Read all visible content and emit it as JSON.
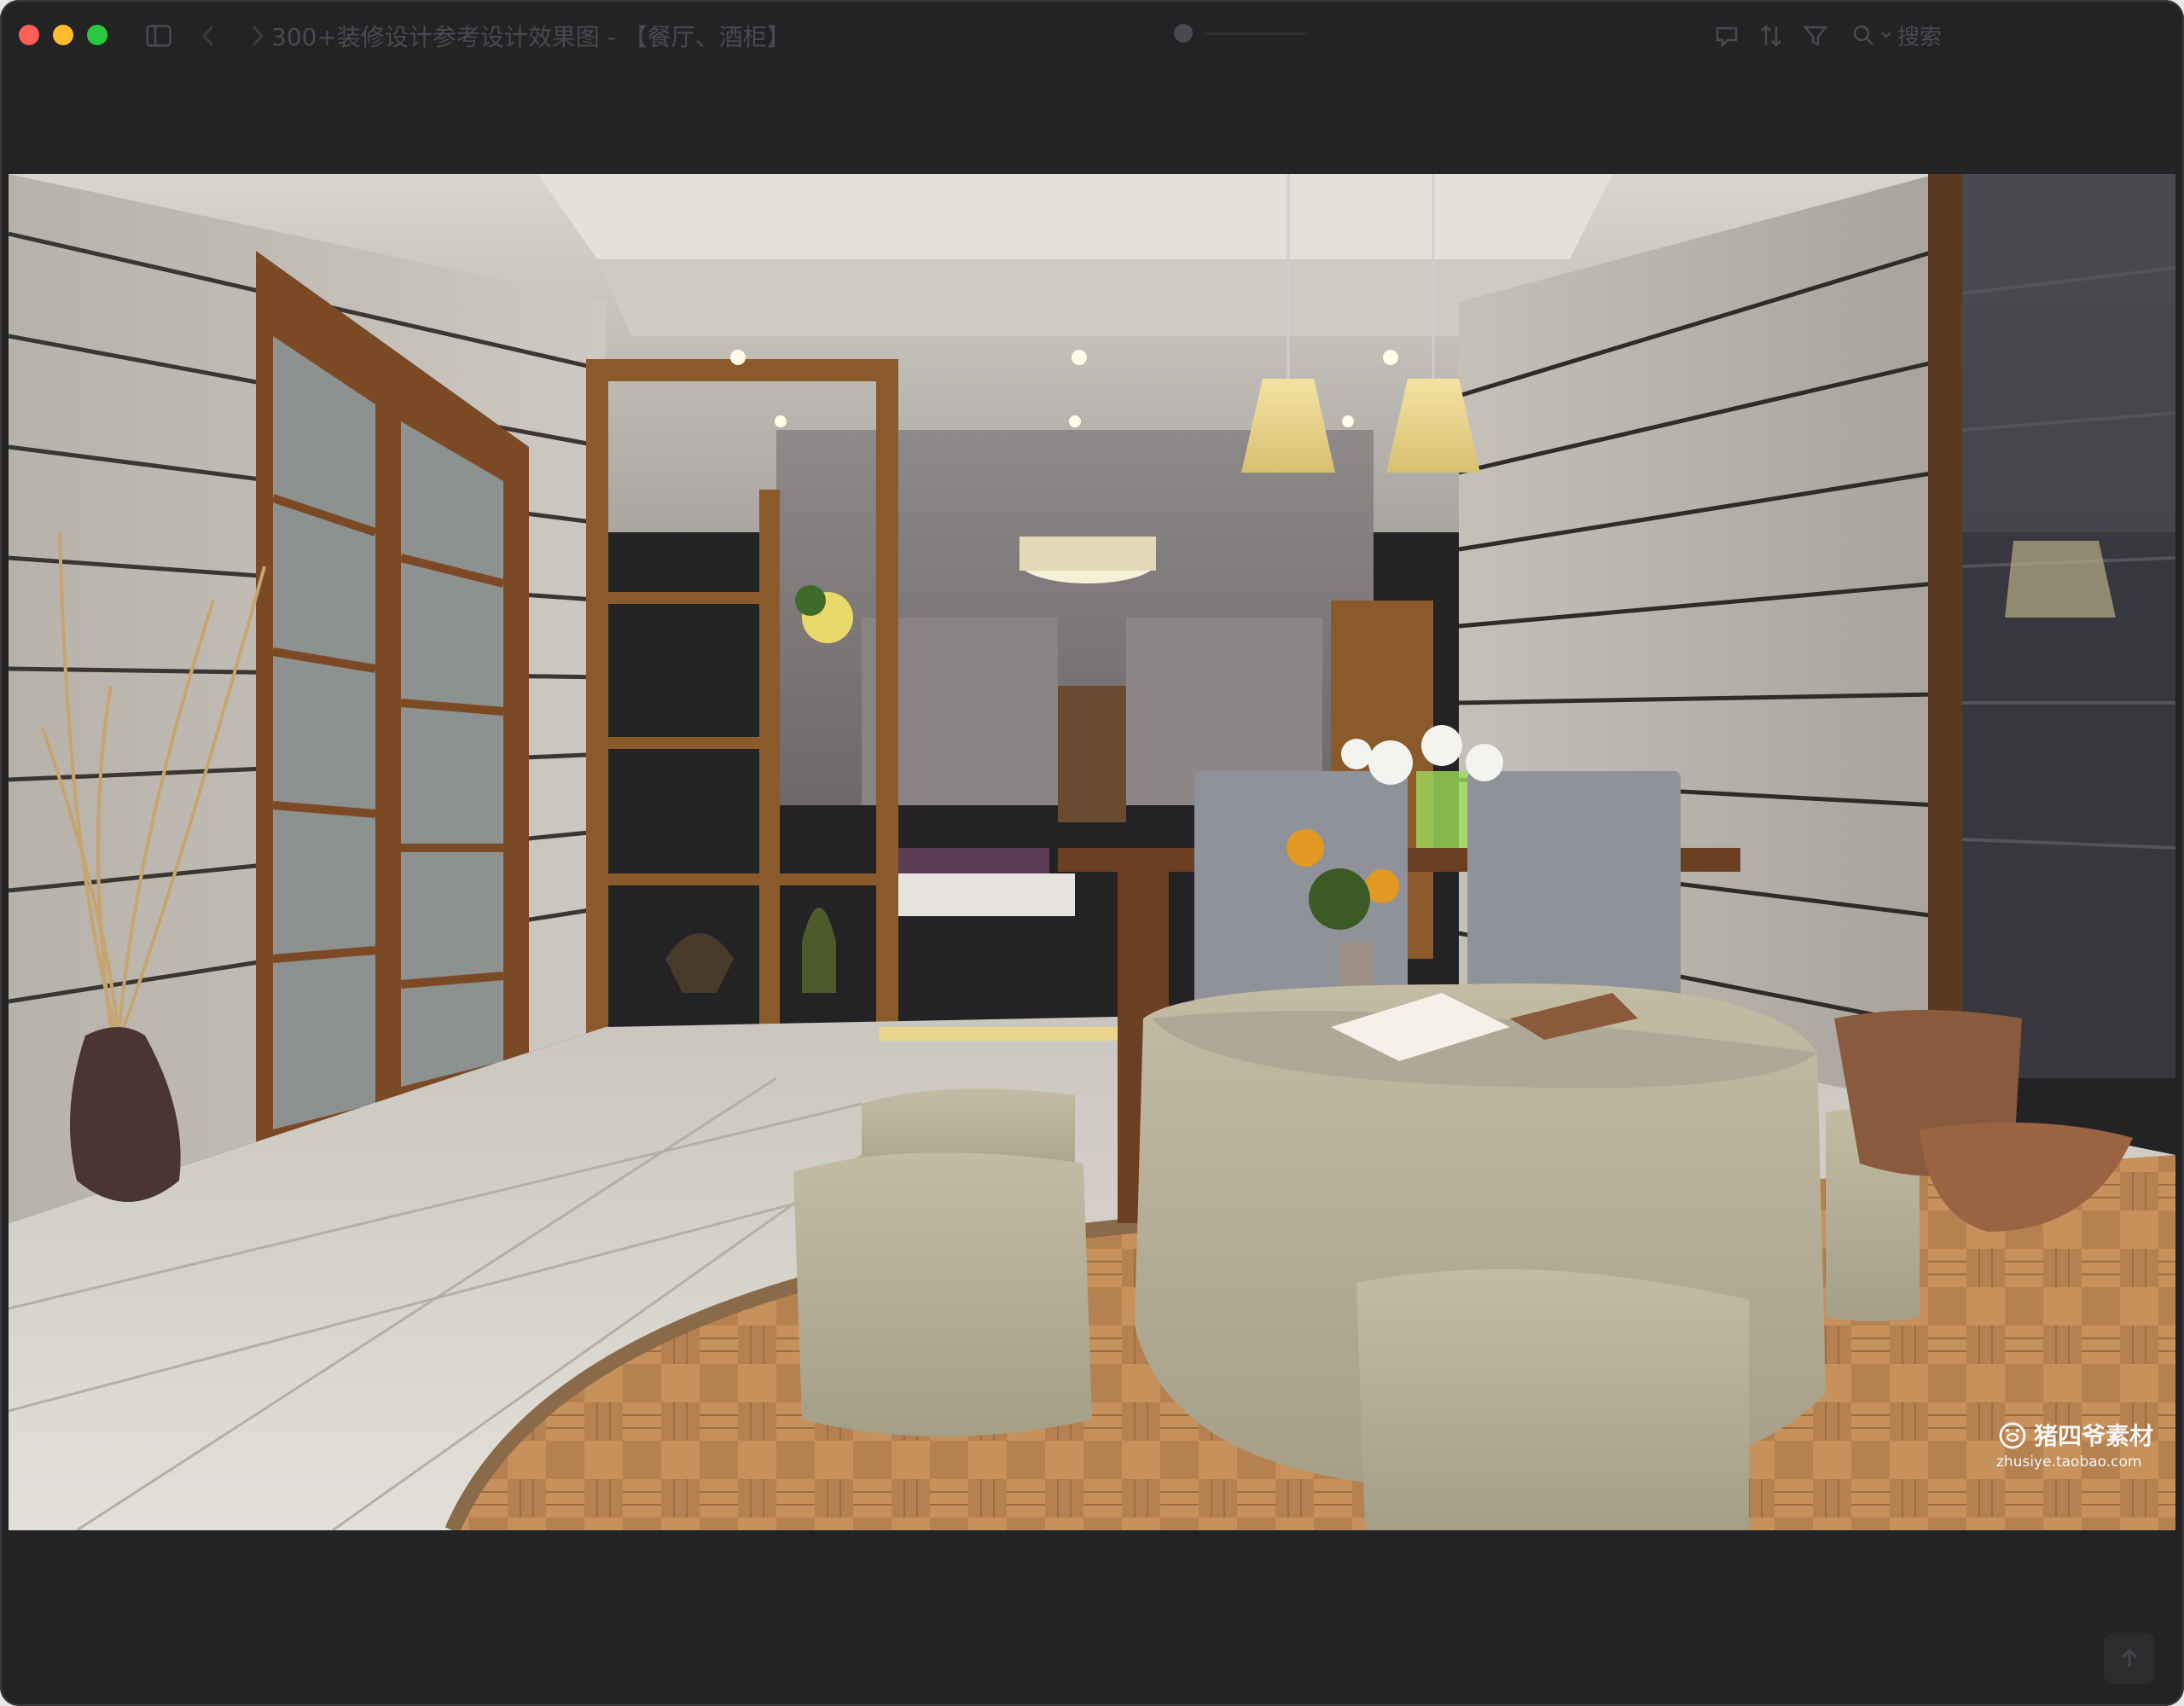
{
  "window": {
    "title": "300+装修设计参考设计效果图 - 【餐厅、酒柜】"
  },
  "toolbar": {
    "search_placeholder": "搜索"
  },
  "icons": {
    "sidebar": "sidebar-icon",
    "back": "chevron-left-icon",
    "forward": "chevron-right-icon",
    "annotate": "markup-icon",
    "sort": "sort-icon",
    "filter": "filter-icon",
    "search": "search-icon",
    "scroll_top": "arrow-up-icon"
  },
  "image": {
    "watermark_title": "猪四爷素材",
    "watermark_url": "zhusiye.taobao.com"
  },
  "colors": {
    "close": "#fe5f57",
    "minimize": "#febc2e",
    "zoom": "#28c840",
    "window_bg": "#232326"
  }
}
